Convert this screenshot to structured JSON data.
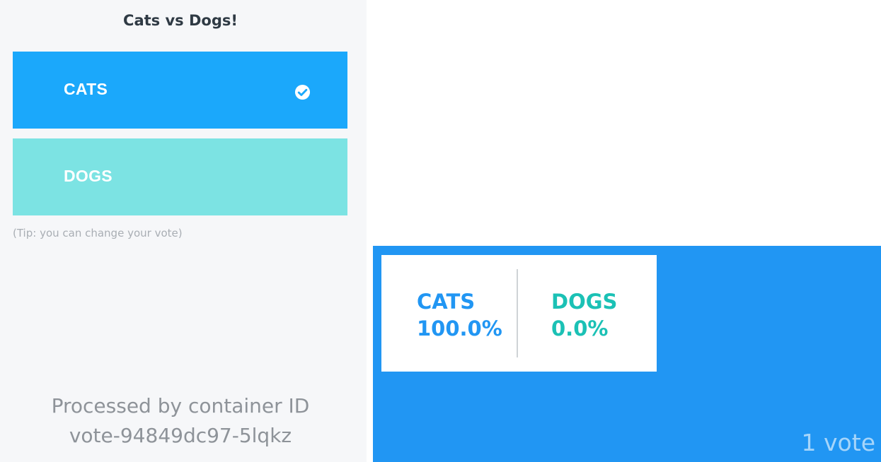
{
  "vote": {
    "title": "Cats vs Dogs!",
    "options": [
      {
        "label": "CATS",
        "selected": true,
        "color": "#1ba8fb",
        "icon": "check-circle-icon"
      },
      {
        "label": "DOGS",
        "selected": false,
        "color": "#7ce3e3"
      }
    ],
    "tip": "(Tip: you can change your vote)",
    "container_line1": "Processed by container ID",
    "container_line2": "vote-94849dc97-5lqkz"
  },
  "results": {
    "background": "#2196f3",
    "cats": {
      "label": "CATS",
      "percent": "100.0%",
      "color": "#2196f3"
    },
    "dogs": {
      "label": "DOGS",
      "percent": "0.0%",
      "color": "#1bc1b5"
    },
    "vote_count": "1 vote"
  }
}
